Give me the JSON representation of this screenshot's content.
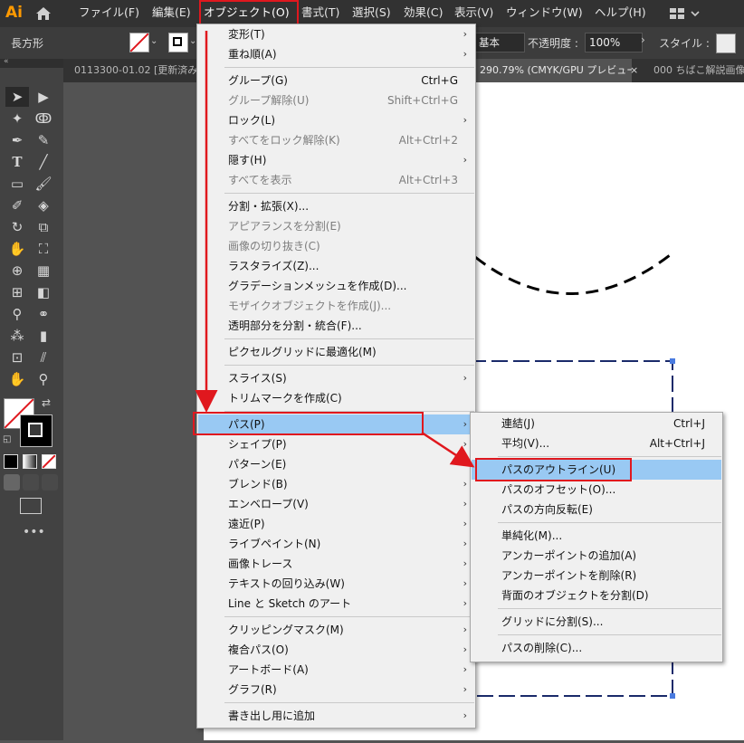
{
  "app": {
    "logo": "Ai"
  },
  "menubar": {
    "items": [
      "ファイル(F)",
      "編集(E)",
      "オブジェクト(O)",
      "書式(T)",
      "選択(S)",
      "効果(C)",
      "表示(V)",
      "ウィンドウ(W)",
      "ヘルプ(H)"
    ],
    "active": "オブジェクト(O)"
  },
  "control_bar": {
    "object_type": "長方形",
    "style_label": "基本",
    "opacity_label": "不透明度 :",
    "opacity_value": "100%",
    "style_field_label": "スタイル :"
  },
  "tabs": [
    {
      "label": "0113300-01.02 [更新済み]"
    },
    {
      "label": "290.79% (CMYK/GPU プレビュー)"
    },
    {
      "label": "000 ちばこ解説画像"
    }
  ],
  "tab_close": "×",
  "object_menu": {
    "items": [
      {
        "label": "変形(T)",
        "submenu": true
      },
      {
        "label": "重ね順(A)",
        "submenu": true
      },
      {
        "sep": true
      },
      {
        "label": "グループ(G)",
        "shortcut": "Ctrl+G"
      },
      {
        "label": "グループ解除(U)",
        "shortcut": "Shift+Ctrl+G",
        "disabled": true
      },
      {
        "label": "ロック(L)",
        "submenu": true
      },
      {
        "label": "すべてをロック解除(K)",
        "shortcut": "Alt+Ctrl+2",
        "disabled": true
      },
      {
        "label": "隠す(H)",
        "submenu": true
      },
      {
        "label": "すべてを表示",
        "shortcut": "Alt+Ctrl+3",
        "disabled": true
      },
      {
        "sep": true
      },
      {
        "label": "分割・拡張(X)..."
      },
      {
        "label": "アピアランスを分割(E)",
        "disabled": true
      },
      {
        "label": "画像の切り抜き(C)",
        "disabled": true
      },
      {
        "label": "ラスタライズ(Z)..."
      },
      {
        "label": "グラデーションメッシュを作成(D)..."
      },
      {
        "label": "モザイクオブジェクトを作成(J)...",
        "disabled": true
      },
      {
        "label": "透明部分を分割・統合(F)..."
      },
      {
        "sep": true
      },
      {
        "label": "ピクセルグリッドに最適化(M)"
      },
      {
        "sep": true
      },
      {
        "label": "スライス(S)",
        "submenu": true
      },
      {
        "label": "トリムマークを作成(C)"
      },
      {
        "sep": true
      },
      {
        "label": "パス(P)",
        "submenu": true,
        "highlighted": true
      },
      {
        "label": "シェイプ(P)",
        "submenu": true
      },
      {
        "label": "パターン(E)",
        "submenu": true
      },
      {
        "label": "ブレンド(B)",
        "submenu": true
      },
      {
        "label": "エンベロープ(V)",
        "submenu": true
      },
      {
        "label": "遠近(P)",
        "submenu": true
      },
      {
        "label": "ライブペイント(N)",
        "submenu": true
      },
      {
        "label": "画像トレース",
        "submenu": true
      },
      {
        "label": "テキストの回り込み(W)",
        "submenu": true
      },
      {
        "label": "Line と Sketch のアート",
        "submenu": true
      },
      {
        "sep": true
      },
      {
        "label": "クリッピングマスク(M)",
        "submenu": true
      },
      {
        "label": "複合パス(O)",
        "submenu": true
      },
      {
        "label": "アートボード(A)",
        "submenu": true
      },
      {
        "label": "グラフ(R)",
        "submenu": true
      },
      {
        "sep": true
      },
      {
        "label": "書き出し用に追加",
        "submenu": true
      }
    ]
  },
  "path_submenu": {
    "items": [
      {
        "label": "連結(J)",
        "shortcut": "Ctrl+J"
      },
      {
        "label": "平均(V)...",
        "shortcut": "Alt+Ctrl+J"
      },
      {
        "sep": true
      },
      {
        "label": "パスのアウトライン(U)",
        "highlighted": true
      },
      {
        "label": "パスのオフセット(O)..."
      },
      {
        "label": "パスの方向反転(E)"
      },
      {
        "sep": true
      },
      {
        "label": "単純化(M)..."
      },
      {
        "label": "アンカーポイントの追加(A)"
      },
      {
        "label": "アンカーポイントを削除(R)"
      },
      {
        "label": "背面のオブジェクトを分割(D)"
      },
      {
        "sep": true
      },
      {
        "label": "グリッドに分割(S)..."
      },
      {
        "sep": true
      },
      {
        "label": "パスの削除(C)..."
      }
    ]
  },
  "tools": [
    "selection-icon",
    "direct-selection-icon",
    "magic-wand-icon",
    "lasso-icon",
    "pen-icon",
    "curvature-icon",
    "type-icon",
    "line-icon",
    "rectangle-icon",
    "paintbrush-icon",
    "shaper-icon",
    "eraser-icon",
    "rotate-icon",
    "scale-icon",
    "warp-icon",
    "free-transform-icon",
    "shape-builder-icon",
    "perspective-grid-icon",
    "mesh-icon",
    "gradient-icon",
    "eyedropper-icon",
    "blend-icon",
    "symbol-sprayer-icon",
    "column-graph-icon",
    "artboard-icon",
    "slice-icon",
    "hand-icon",
    "zoom-icon"
  ],
  "colors": {
    "highlight": "#99c9f3",
    "annotation_red": "#e0181e",
    "logo": "#ff9a00"
  }
}
